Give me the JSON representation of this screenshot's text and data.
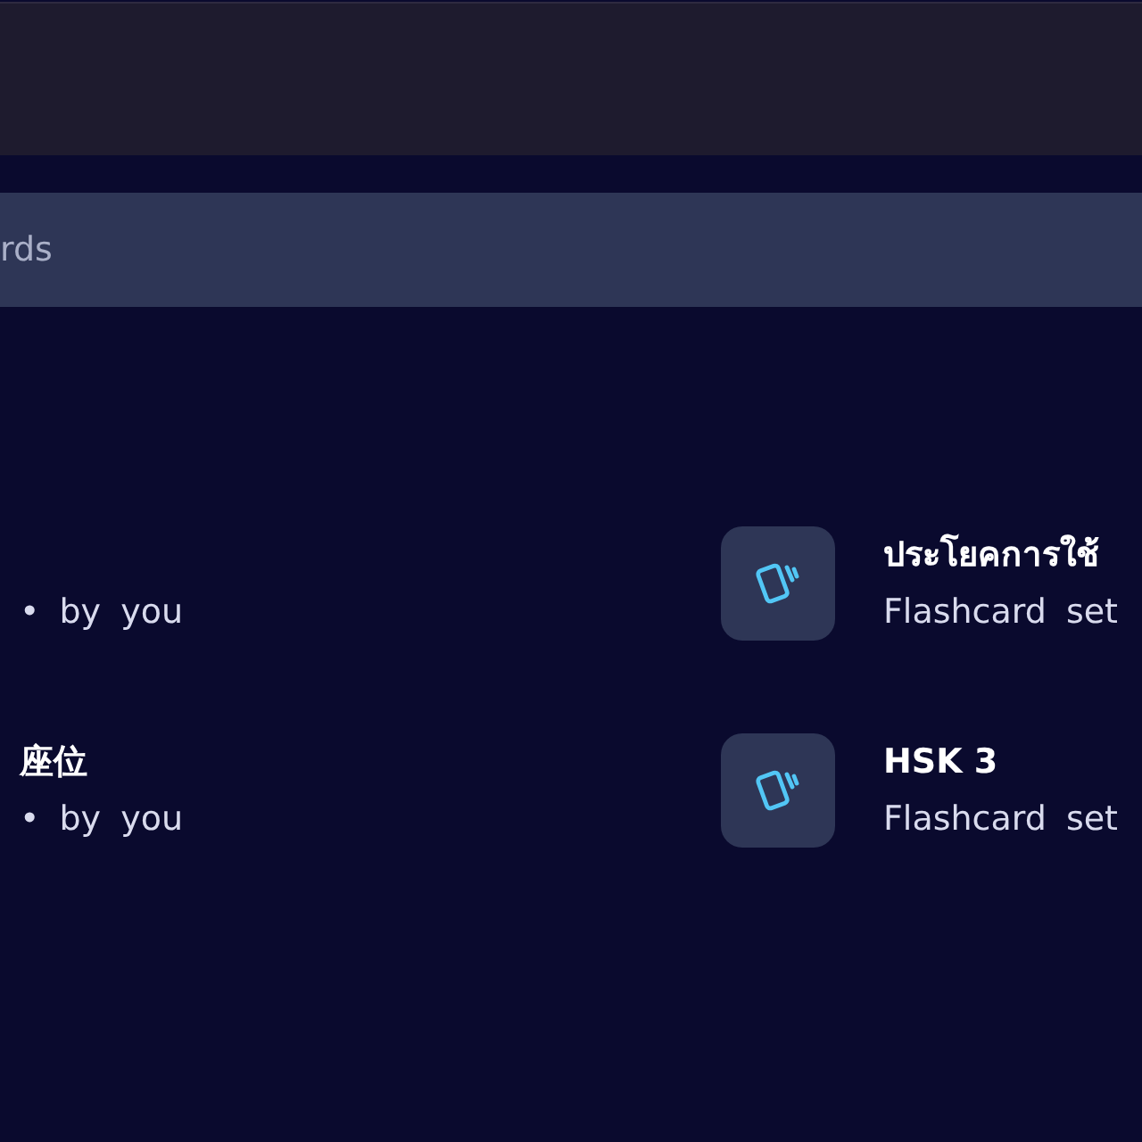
{
  "search": {
    "placeholder": "rds"
  },
  "left_list": [
    {
      "subtitle": "• by you"
    },
    {
      "title": "座位",
      "subtitle": "• by you"
    }
  ],
  "right_list": [
    {
      "title": "ประโยคการใช้",
      "subtitle": "Flashcard set"
    },
    {
      "title": "HSK 3",
      "subtitle": "Flashcard set"
    }
  ]
}
